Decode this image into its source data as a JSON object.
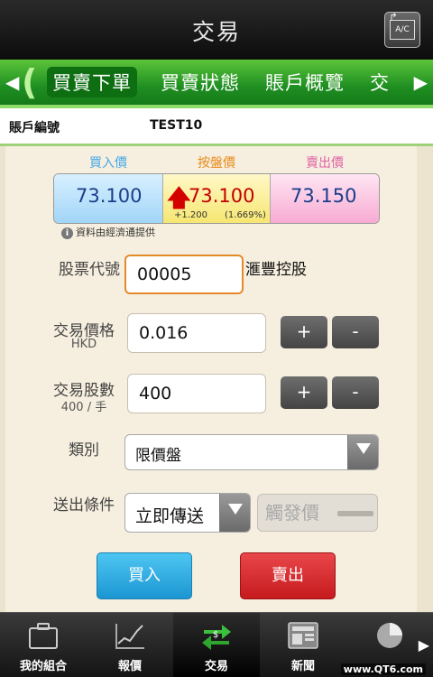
{
  "header": {
    "title": "交易",
    "ac_label": "A/C"
  },
  "tabs": [
    {
      "label": "買賣下單",
      "active": true
    },
    {
      "label": "買賣狀態",
      "active": false
    },
    {
      "label": "賬戶概覽",
      "active": false
    },
    {
      "label": "交",
      "active": false
    }
  ],
  "account": {
    "label": "賬戶編號",
    "value": "TEST10"
  },
  "quote": {
    "bid_label": "買入價",
    "nominal_label": "按盤價",
    "ask_label": "賣出價",
    "bid": "73.100",
    "nominal": "73.100",
    "ask": "73.150",
    "change": "+1.200",
    "change_pct": "(1.669%)",
    "source": "資料由經濟通提供",
    "direction": "up"
  },
  "form": {
    "stock_code_label": "股票代號",
    "stock_code": "00005",
    "stock_name": "滙豐控股",
    "price_label": "交易價格",
    "price_currency": "HKD",
    "price": "0.016",
    "qty_label": "交易股數",
    "lot_size": "400 / 手",
    "qty": "400",
    "plus": "+",
    "minus": "-",
    "type_label": "類別",
    "type_value": "限價盤",
    "condition_label": "送出條件",
    "condition_value": "立即傳送",
    "trigger_placeholder": "觸發價",
    "buy_label": "買入",
    "sell_label": "賣出"
  },
  "nav": [
    {
      "label": "我的組合",
      "icon": "briefcase-icon"
    },
    {
      "label": "報價",
      "icon": "chart-icon"
    },
    {
      "label": "交易",
      "icon": "exchange-icon",
      "active": true
    },
    {
      "label": "新聞",
      "icon": "newspaper-icon"
    },
    {
      "label": "",
      "icon": "pie-chart-icon"
    }
  ],
  "watermark": "www.QT6.com",
  "colors": {
    "accent_green": "#1f8f22",
    "buy_blue": "#1c96d2",
    "sell_red": "#c51a1e",
    "up_red": "#d40000"
  }
}
